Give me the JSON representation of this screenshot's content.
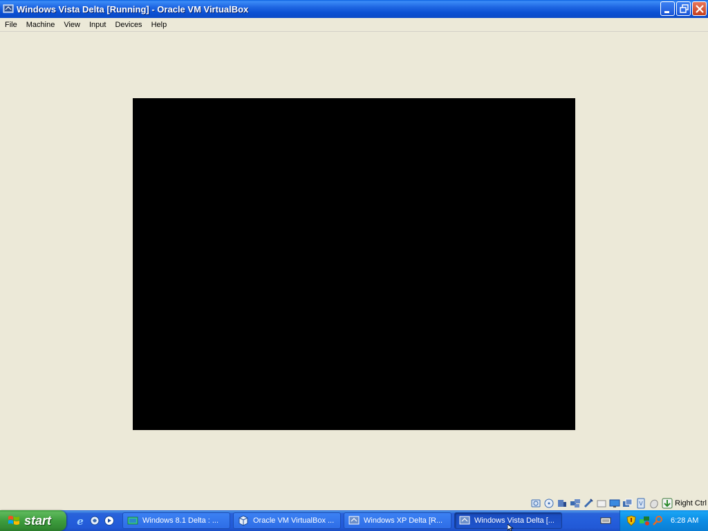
{
  "window": {
    "title": "Windows Vista Delta [Running] - Oracle VM VirtualBox",
    "controls": [
      "minimize-icon",
      "restore-icon",
      "close-icon"
    ]
  },
  "menu": {
    "items": [
      "File",
      "Machine",
      "View",
      "Input",
      "Devices",
      "Help"
    ]
  },
  "statusbar": {
    "icons": [
      "hard-disk-icon",
      "optical-drive-icon",
      "audio-icon",
      "network-icon",
      "usb-icon",
      "shared-folders-icon",
      "display-icon",
      "video-capture-icon",
      "virtualization-icon",
      "mouse-integration-icon",
      "keyboard-capture-icon"
    ],
    "host_key": "Right Ctrl"
  },
  "taskbar": {
    "start_label": "start",
    "quicklaunch": [
      "internet-explorer-icon",
      "firefox-icon",
      "media-player-icon"
    ],
    "tasks": [
      {
        "label": "Windows 8.1 Delta : ...",
        "icon": "window-icon",
        "active": false
      },
      {
        "label": "Oracle VM VirtualBox ...",
        "icon": "virtualbox-icon",
        "active": false
      },
      {
        "label": "Windows XP Delta [R...",
        "icon": "virtualbox-vm-icon",
        "active": false
      },
      {
        "label": "Windows Vista Delta [...",
        "icon": "virtualbox-vm-icon",
        "active": true
      }
    ],
    "tray_icons": [
      "security-shield-icon",
      "network-status-icon",
      "search-icon"
    ],
    "clock": "6:28 AM"
  },
  "colors": {
    "titlebar": "#0B50D3",
    "background": "#ECE9D8",
    "vm_screen": "#000000",
    "start": "#3E9D3E",
    "taskbar": "#245EDB",
    "tray": "#0D8DE5"
  }
}
